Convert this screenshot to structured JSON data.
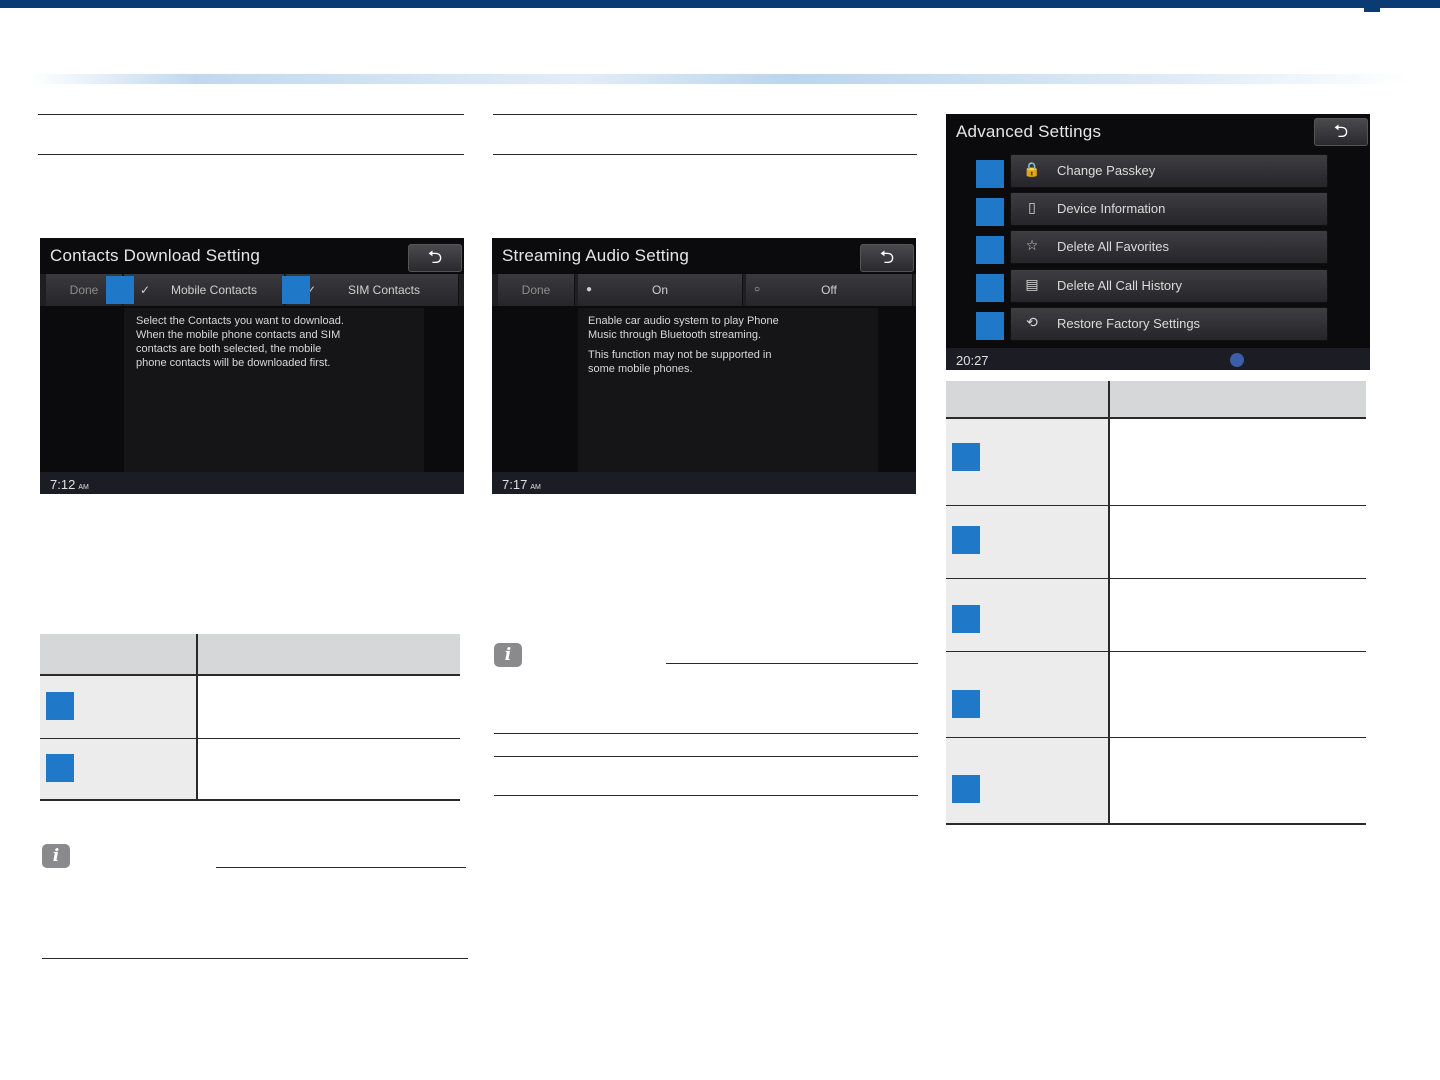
{
  "colors": {
    "page_top_bar": "#0a3b73",
    "callout_marker": "#1f78c8",
    "table_header": "#d6d7d9",
    "table_row": "#ececec",
    "screen_bg": "#0b0b0d"
  },
  "contacts_screen": {
    "title": "Contacts Download Setting",
    "back_icon": "back-arrow-icon",
    "options": {
      "done": "Done",
      "mobile": "Mobile Contacts",
      "sim": "SIM Contacts"
    },
    "check_glyph": "✓",
    "message": "Select the Contacts you want to download.\nWhen the mobile phone contacts and SIM\ncontacts are both selected, the mobile\nphone contacts will be downloaded first.",
    "clock": "7:12",
    "clock_suffix": "AM"
  },
  "streaming_screen": {
    "title": "Streaming Audio Setting",
    "back_icon": "back-arrow-icon",
    "options": {
      "done": "Done",
      "on": "On",
      "off": "Off"
    },
    "message_1": "Enable car audio system to play Phone\nMusic through Bluetooth streaming.",
    "message_2": "This function may not be supported in\nsome mobile phones.",
    "clock": "7:17",
    "clock_suffix": "AM"
  },
  "advanced_screen": {
    "title": "Advanced Settings",
    "back_icon": "back-arrow-icon",
    "items": [
      {
        "label": "Change Passkey",
        "icon": "lock-icon"
      },
      {
        "label": "Device Information",
        "icon": "phone-icon"
      },
      {
        "label": "Delete All Favorites",
        "icon": "star-delete-icon"
      },
      {
        "label": "Delete All Call History",
        "icon": "call-history-delete-icon"
      },
      {
        "label": "Restore Factory Settings",
        "icon": "restore-icon"
      }
    ],
    "clock": "20:27",
    "status_icon": "bluetooth-status-icon"
  },
  "info_icon_glyph": "i"
}
